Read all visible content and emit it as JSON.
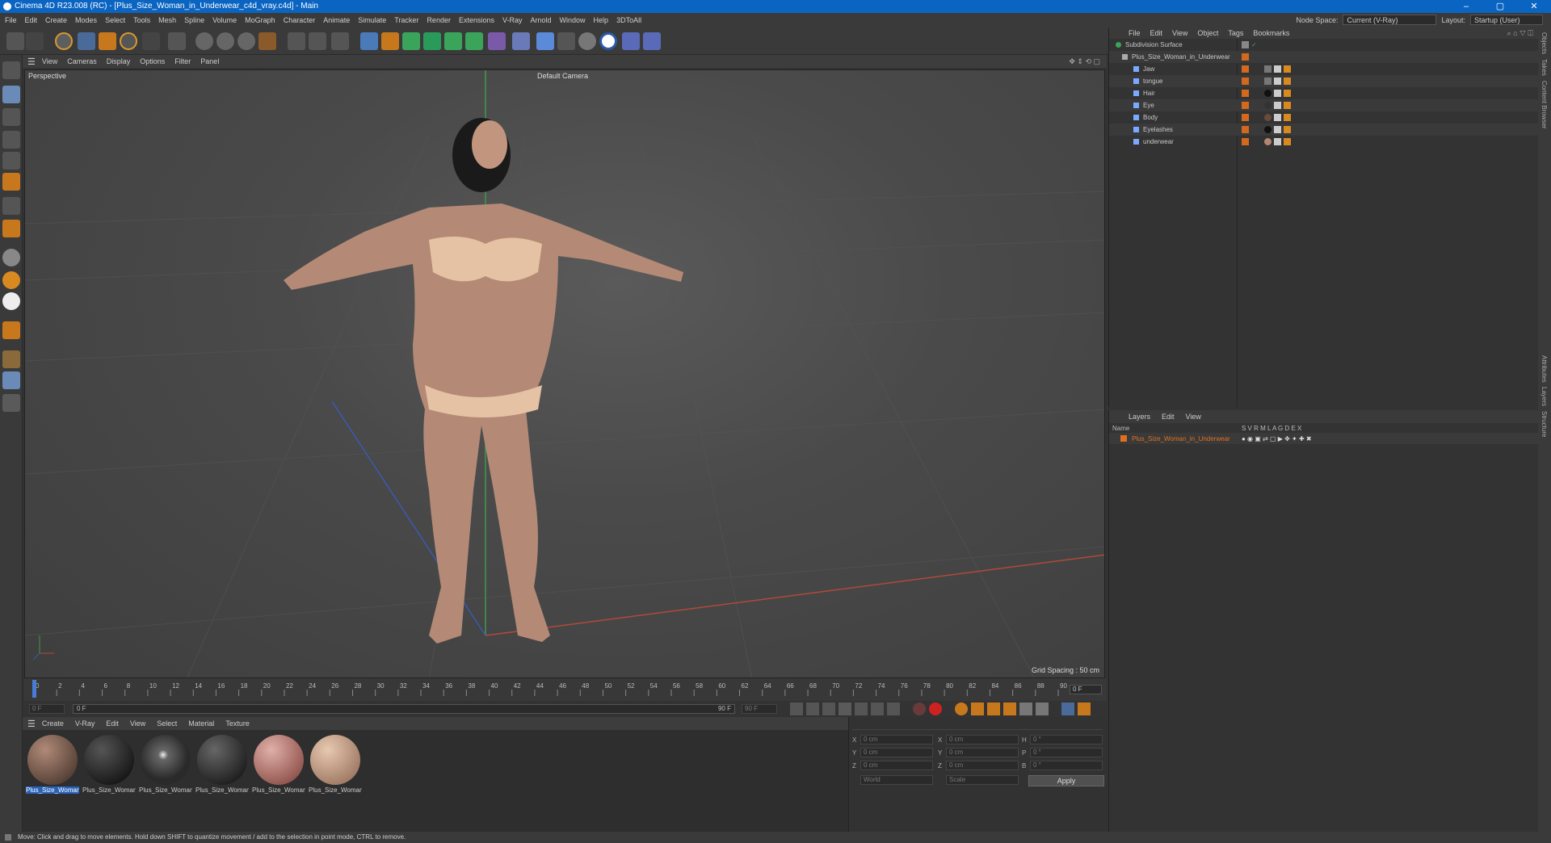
{
  "window": {
    "title": "Cinema 4D R23.008 (RC) - [Plus_Size_Woman_in_Underwear_c4d_vray.c4d] - Main",
    "buttons": [
      "–",
      "▢",
      "✕"
    ]
  },
  "menubar": {
    "items": [
      "File",
      "Edit",
      "Create",
      "Modes",
      "Select",
      "Tools",
      "Mesh",
      "Spline",
      "Volume",
      "MoGraph",
      "Character",
      "Animate",
      "Simulate",
      "Tracker",
      "Render",
      "Extensions",
      "V-Ray",
      "Arnold",
      "Window",
      "Help",
      "3DToAll"
    ],
    "node_space_label": "Node Space:",
    "node_space_value": "Current (V-Ray)",
    "layout_label": "Layout:",
    "layout_value": "Startup (User)"
  },
  "viewport": {
    "menu": [
      "View",
      "Cameras",
      "Display",
      "Options",
      "Filter",
      "Panel"
    ],
    "projection": "Perspective",
    "camera": "Default Camera",
    "grid_spacing": "Grid Spacing : 50 cm"
  },
  "timeline": {
    "ticks": [
      "0",
      "2",
      "4",
      "6",
      "8",
      "10",
      "12",
      "14",
      "16",
      "18",
      "20",
      "22",
      "24",
      "26",
      "28",
      "30",
      "32",
      "34",
      "36",
      "38",
      "40",
      "42",
      "44",
      "46",
      "48",
      "50",
      "52",
      "54",
      "56",
      "58",
      "60",
      "62",
      "64",
      "66",
      "68",
      "70",
      "72",
      "74",
      "76",
      "78",
      "80",
      "82",
      "84",
      "86",
      "88",
      "90"
    ],
    "current_frame": "0 F",
    "start": "0 F",
    "min": "0 F",
    "max": "90 F",
    "end": "90 F"
  },
  "materials": {
    "menu": [
      "Create",
      "V-Ray",
      "Edit",
      "View",
      "Select",
      "Material",
      "Texture"
    ],
    "items": [
      {
        "label": "Plus_Size_Woman",
        "color": "#6a4a3a"
      },
      {
        "label": "Plus_Size_Woman",
        "color": "#1a1a1a"
      },
      {
        "label": "Plus_Size_Woman",
        "color": "#3a3a3a"
      },
      {
        "label": "Plus_Size_Woman",
        "color": "#222222"
      },
      {
        "label": "Plus_Size_Woman",
        "color": "#8a4a44"
      },
      {
        "label": "Plus_Size_Woman",
        "color": "#b08870"
      }
    ]
  },
  "coordinates": {
    "pos_labels": [
      "X",
      "Y",
      "Z"
    ],
    "pos_values": [
      "0 cm",
      "0 cm",
      "0 cm"
    ],
    "size_labels": [
      "X",
      "Y",
      "Z"
    ],
    "size_values": [
      "0 cm",
      "0 cm",
      "0 cm"
    ],
    "rot_labels": [
      "H",
      "P",
      "B"
    ],
    "rot_values": [
      "0 °",
      "0 °",
      "0 °"
    ],
    "mode_world": "World",
    "mode_scale": "Scale",
    "apply": "Apply"
  },
  "object_manager": {
    "menu": [
      "File",
      "Edit",
      "View",
      "Object",
      "Tags",
      "Bookmarks"
    ],
    "objects": [
      {
        "name": "Subdivision Surface",
        "indent": 0
      },
      {
        "name": "Plus_Size_Woman_in_Underwear",
        "indent": 1
      },
      {
        "name": "Jaw",
        "indent": 2
      },
      {
        "name": "tongue",
        "indent": 2
      },
      {
        "name": "Hair",
        "indent": 2
      },
      {
        "name": "Eye",
        "indent": 2
      },
      {
        "name": "Body",
        "indent": 2
      },
      {
        "name": "Eyelashes",
        "indent": 2
      },
      {
        "name": "underwear",
        "indent": 2
      }
    ]
  },
  "layer_manager": {
    "menu": [
      "Layers",
      "Edit",
      "View"
    ],
    "header_name": "Name",
    "header_flags": "S V R M L A G D E X",
    "layer_name": "Plus_Size_Woman_in_Underwear",
    "layer_color": "#e07020"
  },
  "right_tabs": [
    "Objects",
    "Takes",
    "Content Browser",
    "Attributes",
    "Layers",
    "Structure"
  ],
  "status": "Move: Click and drag to move elements. Hold down SHIFT to quantize movement / add to the selection in point mode, CTRL to remove."
}
